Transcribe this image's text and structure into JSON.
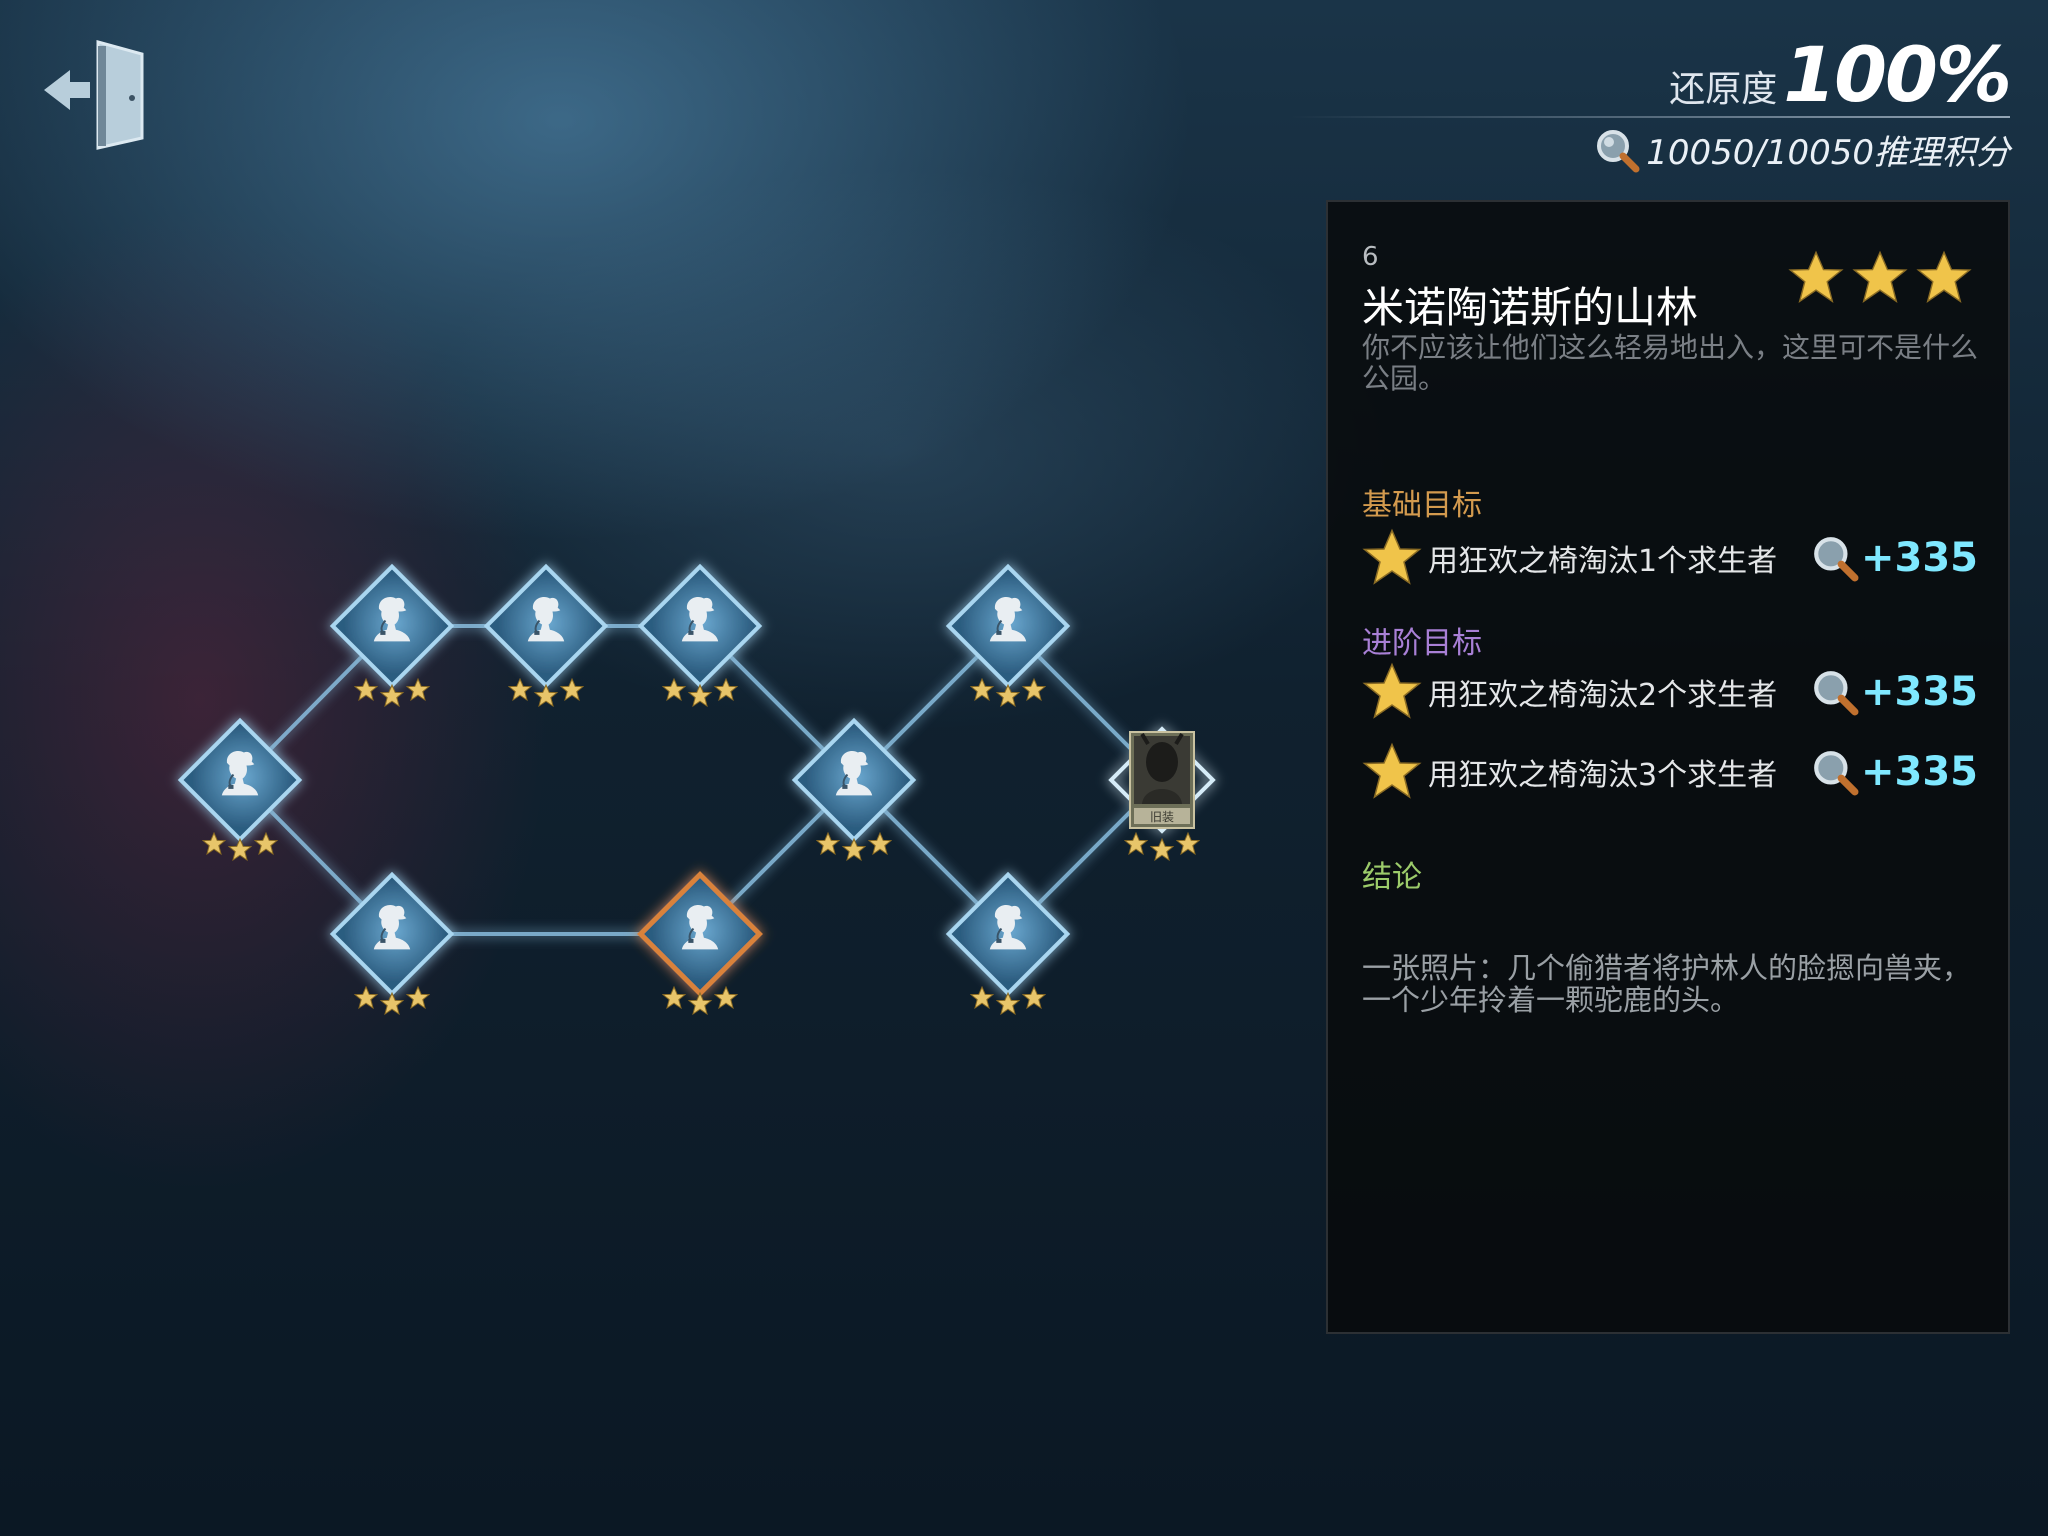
{
  "hud": {
    "restore_label": "还原度",
    "restore_value": "100%",
    "score_text": "10050/10050推理积分"
  },
  "map": {
    "node_icon": "detective-silhouette-icon",
    "final_node_icon": "character-portrait-icon",
    "final_node_caption": "旧装",
    "nodes": [
      {
        "stars": 3,
        "selected": false
      },
      {
        "stars": 3,
        "selected": false
      },
      {
        "stars": 3,
        "selected": false
      },
      {
        "stars": 3,
        "selected": false
      },
      {
        "stars": 3,
        "selected": false
      },
      {
        "stars": 3,
        "selected": true
      },
      {
        "stars": 3,
        "selected": false
      },
      {
        "stars": 3,
        "selected": false
      },
      {
        "stars": 3,
        "selected": false
      },
      {
        "stars": 3,
        "selected": false
      }
    ],
    "colors": {
      "node": "#4a8fbf",
      "node_edge": "#a9d6f0",
      "selected_edge": "#d9823a",
      "star": "#e8c56a",
      "link": "#8cc2e4"
    }
  },
  "panel": {
    "index": "6",
    "title": "米诺陶诺斯的山林",
    "stars": 3,
    "description": "你不应该让他们这么轻易地出入，这里可不是什么公园。",
    "basic_title": "基础目标",
    "advanced_title": "进阶目标",
    "goals": [
      {
        "text": "用狂欢之椅淘汰1个求生者",
        "points": "+335"
      },
      {
        "text": "用狂欢之椅淘汰2个求生者",
        "points": "+335"
      },
      {
        "text": "用狂欢之椅淘汰3个求生者",
        "points": "+335"
      }
    ],
    "conclusion_title": "结论",
    "conclusion_text": "一张照片：几个偷猎者将护林人的脸摁向兽夹，一个少年拎着一颗驼鹿的头。",
    "colors": {
      "basic": "#d39a4e",
      "advanced": "#a980d6",
      "conclusion": "#9ccb6a",
      "points": "#7fe8ff",
      "star": "#f0c44a"
    }
  }
}
